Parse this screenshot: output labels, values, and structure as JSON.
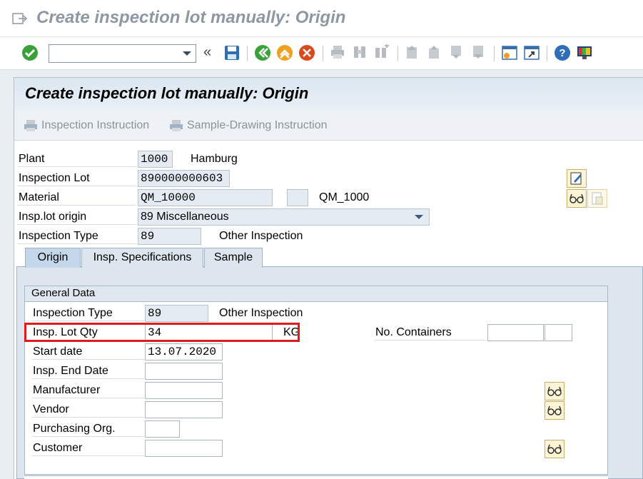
{
  "window": {
    "title": "Create inspection lot manually: Origin"
  },
  "screen": {
    "title": "Create inspection lot manually: Origin"
  },
  "app_toolbar": {
    "inspection_instruction": "Inspection Instruction",
    "sample_drawing_instruction": "Sample-Drawing Instruction"
  },
  "header": {
    "plant_label": "Plant",
    "plant_value": "1000",
    "plant_name": "Hamburg",
    "lot_label": "Inspection Lot",
    "lot_value": "890000000603",
    "material_label": "Material",
    "material_value": "QM_10000",
    "material_desc": "QM_1000",
    "origin_label": "Insp.lot origin",
    "origin_value": "89 Miscellaneous",
    "type_label": "Inspection Type",
    "type_value": "89",
    "type_desc": "Other Inspection"
  },
  "tabs": [
    {
      "label": "Origin",
      "active": true
    },
    {
      "label": "Insp. Specifications",
      "active": false
    },
    {
      "label": "Sample",
      "active": false
    }
  ],
  "general": {
    "title": "General Data",
    "type_label": "Inspection Type",
    "type_value": "89",
    "type_desc": "Other Inspection",
    "qty_label": "Insp. Lot Qty",
    "qty_value": "34",
    "qty_unit": "KG",
    "containers_label": "No. Containers",
    "start_label": "Start date",
    "start_value": "13.07.2020",
    "end_label": "Insp. End Date",
    "manufacturer_label": "Manufacturer",
    "vendor_label": "Vendor",
    "purch_label": "Purchasing Org.",
    "customer_label": "Customer"
  },
  "icons": {
    "enter": "check-icon",
    "save": "save-icon",
    "back": "back-icon",
    "exit": "exit-icon",
    "cancel": "cancel-icon",
    "help": "help-icon"
  },
  "colors": {
    "highlight": "#e01b1b",
    "accent": "#1d7fbf"
  }
}
